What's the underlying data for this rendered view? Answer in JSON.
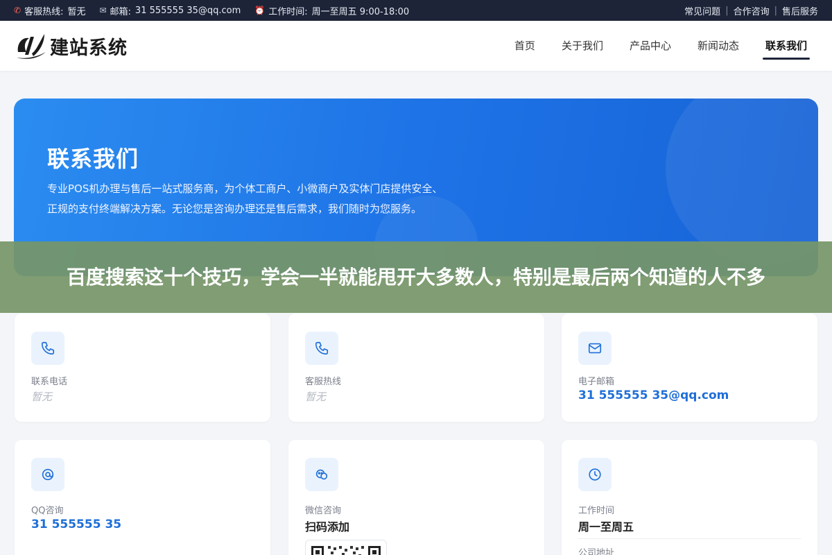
{
  "topbar": {
    "hotline_label": "客服热线:",
    "hotline_value": "暂无",
    "email_label": "邮箱:",
    "email_value": "31 555555 35@qq.com",
    "hours_label": "工作时间:",
    "hours_value": "周一至周五 9:00-18:00",
    "links": [
      "常见问题",
      "合作咨询",
      "售后服务"
    ]
  },
  "header": {
    "logo_text": "建站系统",
    "nav": [
      "首页",
      "关于我们",
      "产品中心",
      "新闻动态",
      "联系我们"
    ],
    "active_nav": "联系我们"
  },
  "hero": {
    "title": "联系我们",
    "description": "专业POS机办理与售后一站式服务商，为个体工商户、小微商户及实体门店提供安全、正规的支付终端解决方案。无论您是咨询办理还是售后需求，我们随时为您服务。"
  },
  "banner": {
    "text": "百度搜索这十个技巧，学会一半就能甩开大多数人，特别是最后两个知道的人不多"
  },
  "cards": [
    {
      "label": "联系电话",
      "value": "暂无",
      "icon": "phone-icon"
    },
    {
      "label": "客服热线",
      "value": "暂无",
      "icon": "phone-icon"
    },
    {
      "label": "电子邮箱",
      "value": "31 555555 35@qq.com",
      "icon": "mail-icon"
    },
    {
      "label": "QQ咨询",
      "value": "31 555555 35",
      "icon": "qq-icon"
    },
    {
      "label": "微信咨询",
      "value": "扫码添加",
      "icon": "wechat-icon"
    },
    {
      "label": "工作时间",
      "value": "周一至周五",
      "icon": "clock-icon",
      "extra_label": "公司地址"
    }
  ],
  "colors": {
    "topbar_bg": "#1d2438",
    "hero_blue": "#1e73e6",
    "accent_blue": "#1f6fd8",
    "banner_green": "#769668"
  }
}
